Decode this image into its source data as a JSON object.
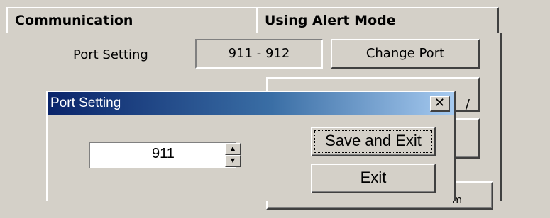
{
  "tabs": [
    {
      "label": "Communication"
    },
    {
      "label": "Using Alert Mode"
    }
  ],
  "communication": {
    "port_setting_label": "Port Setting",
    "port_value": "911 - 912",
    "change_port_button": "Change Port",
    "partial_button_glyph": "/",
    "partial_button_text": "m"
  },
  "dialog": {
    "title": "Port Setting",
    "close_glyph": "✕",
    "spin_value": "911",
    "spin_up_glyph": "▲",
    "spin_down_glyph": "▼",
    "save_exit_button": "Save and Exit",
    "exit_button": "Exit"
  }
}
